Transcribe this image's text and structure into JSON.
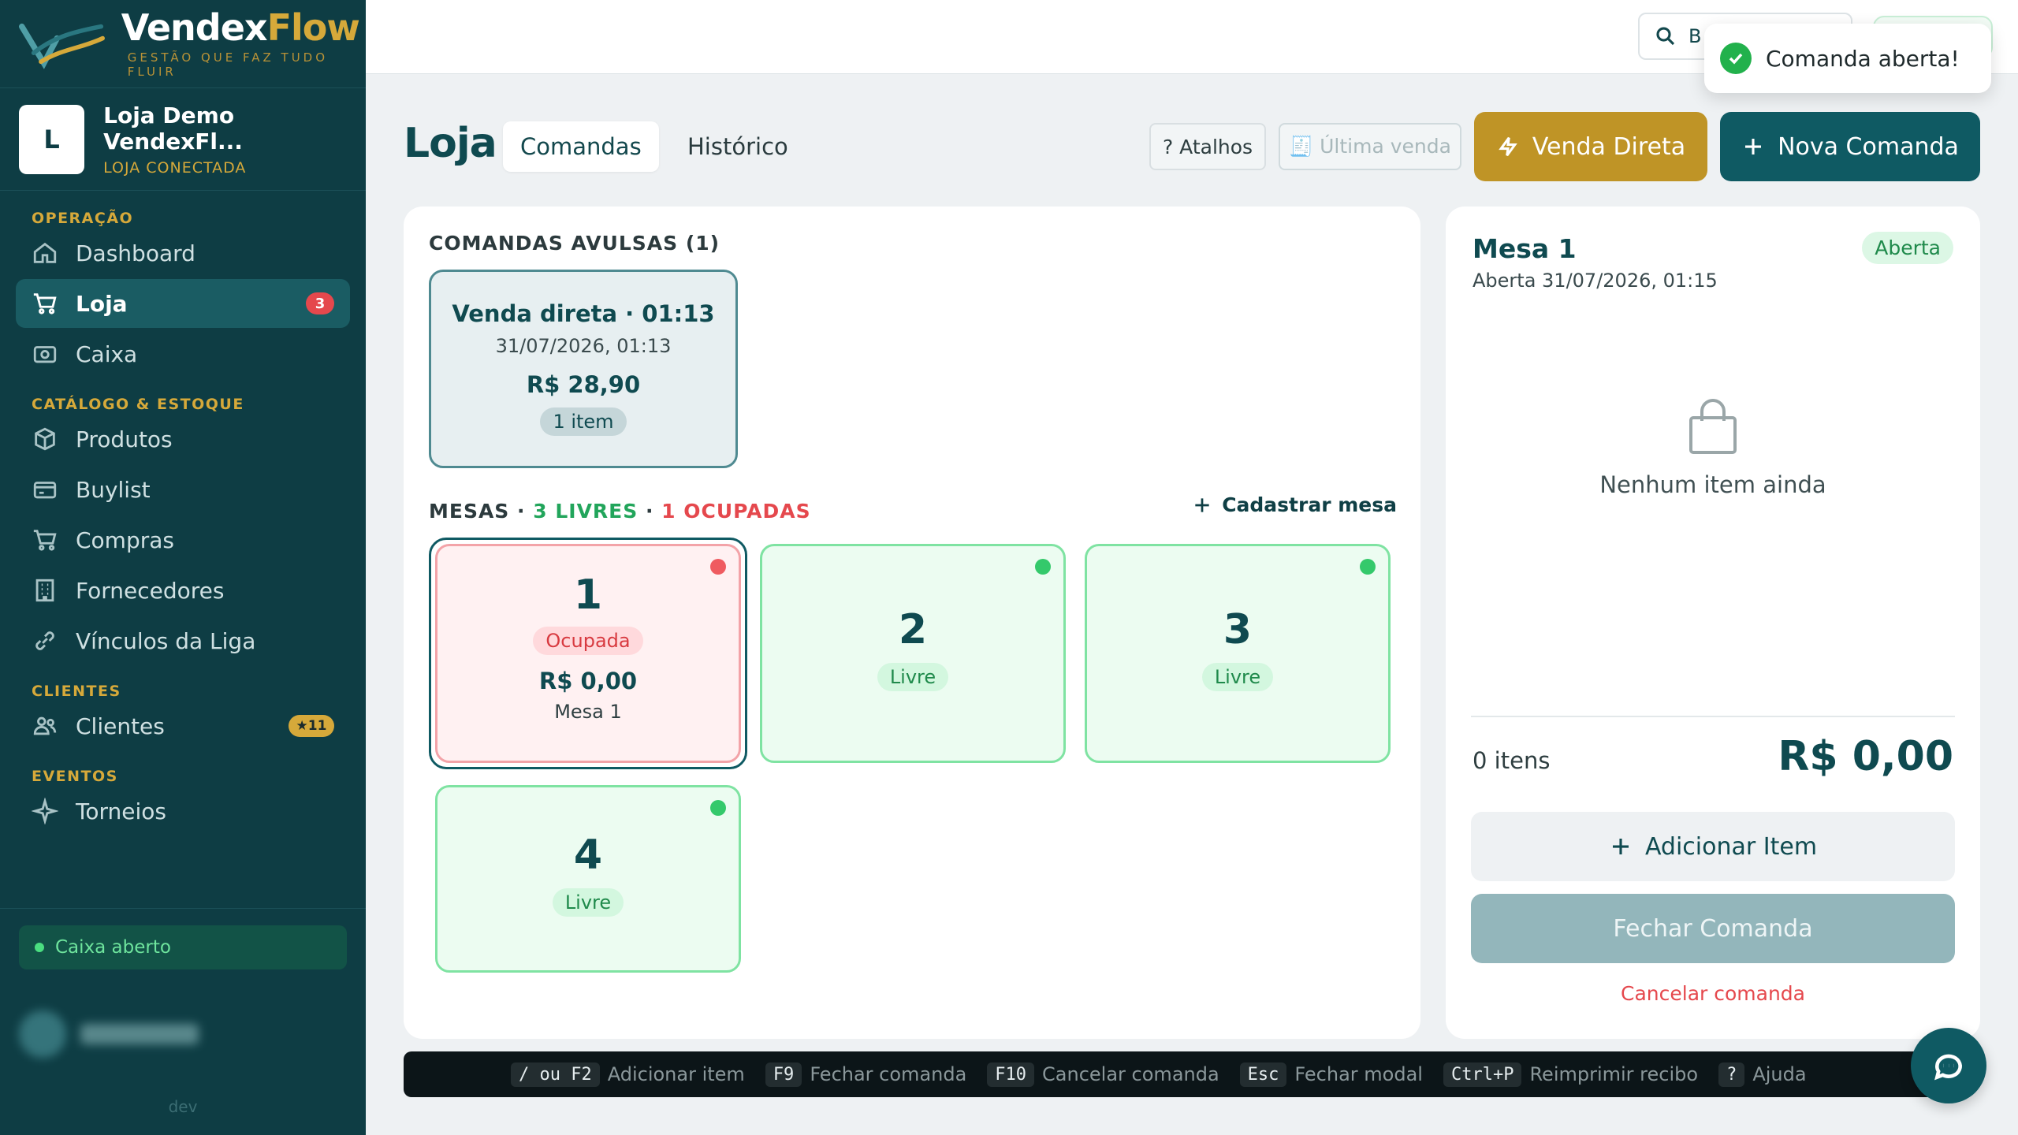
{
  "brand": {
    "name_main": "Vendex",
    "name_accent": "Flow",
    "tagline": "GESTÃO QUE FAZ TUDO FLUIR"
  },
  "store": {
    "initial": "L",
    "name": "Loja Demo VendexFl...",
    "status": "LOJA CONECTADA"
  },
  "nav": {
    "sections": {
      "operacao": "OPERAÇÃO",
      "catalogo": "CATÁLOGO & ESTOQUE",
      "clientes": "CLIENTES",
      "eventos": "EVENTOS"
    },
    "items": [
      {
        "label": "Dashboard",
        "icon": "home-icon"
      },
      {
        "label": "Loja",
        "icon": "cart-icon",
        "badge": "3",
        "active": true
      },
      {
        "label": "Caixa",
        "icon": "cash-register-icon"
      },
      {
        "label": "Produtos",
        "icon": "box-icon"
      },
      {
        "label": "Buylist",
        "icon": "card-icon"
      },
      {
        "label": "Compras",
        "icon": "cart-icon"
      },
      {
        "label": "Fornecedores",
        "icon": "building-icon"
      },
      {
        "label": "Vínculos da Liga",
        "icon": "link-icon"
      },
      {
        "label": "Clientes",
        "icon": "users-icon",
        "badge": "★11"
      },
      {
        "label": "Torneios",
        "icon": "sparkle-icon"
      }
    ]
  },
  "cash_status": "Caixa aberto",
  "dev_tag": "dev",
  "topbar": {
    "search_text": "B"
  },
  "toast": {
    "message": "Comanda aberta!"
  },
  "header": {
    "title": "Loja",
    "tabs": [
      "Comandas",
      "Histórico"
    ],
    "shortcuts_btn": "? Atalhos",
    "last_sale_btn": "🧾 Última venda",
    "direct_sale_btn": "Venda Direta",
    "new_order_btn": "Nova Comanda"
  },
  "standalone_orders": {
    "label": "COMANDAS AVULSAS (1)",
    "cards": [
      {
        "title": "Venda direta · 01:13",
        "date": "31/07/2026, 01:13",
        "price": "R$ 28,90",
        "count": "1 item"
      }
    ]
  },
  "tables": {
    "label": "MESAS",
    "free": "3 LIVRES",
    "busy": "1 OCUPADAS",
    "sep": " · ",
    "add_label": "Cadastrar mesa",
    "cards": [
      {
        "number": "1",
        "status": "Ocupada",
        "value": "R$ 0,00",
        "name": "Mesa 1",
        "occupied": true
      },
      {
        "number": "2",
        "status": "Livre"
      },
      {
        "number": "3",
        "status": "Livre"
      },
      {
        "number": "4",
        "status": "Livre"
      }
    ]
  },
  "detail": {
    "title": "Mesa 1",
    "subtitle": "Aberta 31/07/2026, 01:15",
    "badge": "Aberta",
    "empty": "Nenhum item ainda",
    "items_count": "0 itens",
    "total": "R$ 0,00",
    "add_item": "Adicionar Item",
    "close_order": "Fechar Comanda",
    "cancel_order": "Cancelar comanda"
  },
  "shortcut_bar": [
    {
      "key": "/ ou F2",
      "label": "Adicionar item"
    },
    {
      "key": "F9",
      "label": "Fechar comanda"
    },
    {
      "key": "F10",
      "label": "Cancelar comanda"
    },
    {
      "key": "Esc",
      "label": "Fechar modal"
    },
    {
      "key": "Ctrl+P",
      "label": "Reimprimir recibo"
    },
    {
      "key": "?",
      "label": "Ajuda"
    }
  ],
  "colors": {
    "sidebar": "#0e3d44",
    "gold": "#bf9426",
    "teal": "#0f5a63",
    "free": "#22a55b",
    "busy": "#e5484d"
  }
}
